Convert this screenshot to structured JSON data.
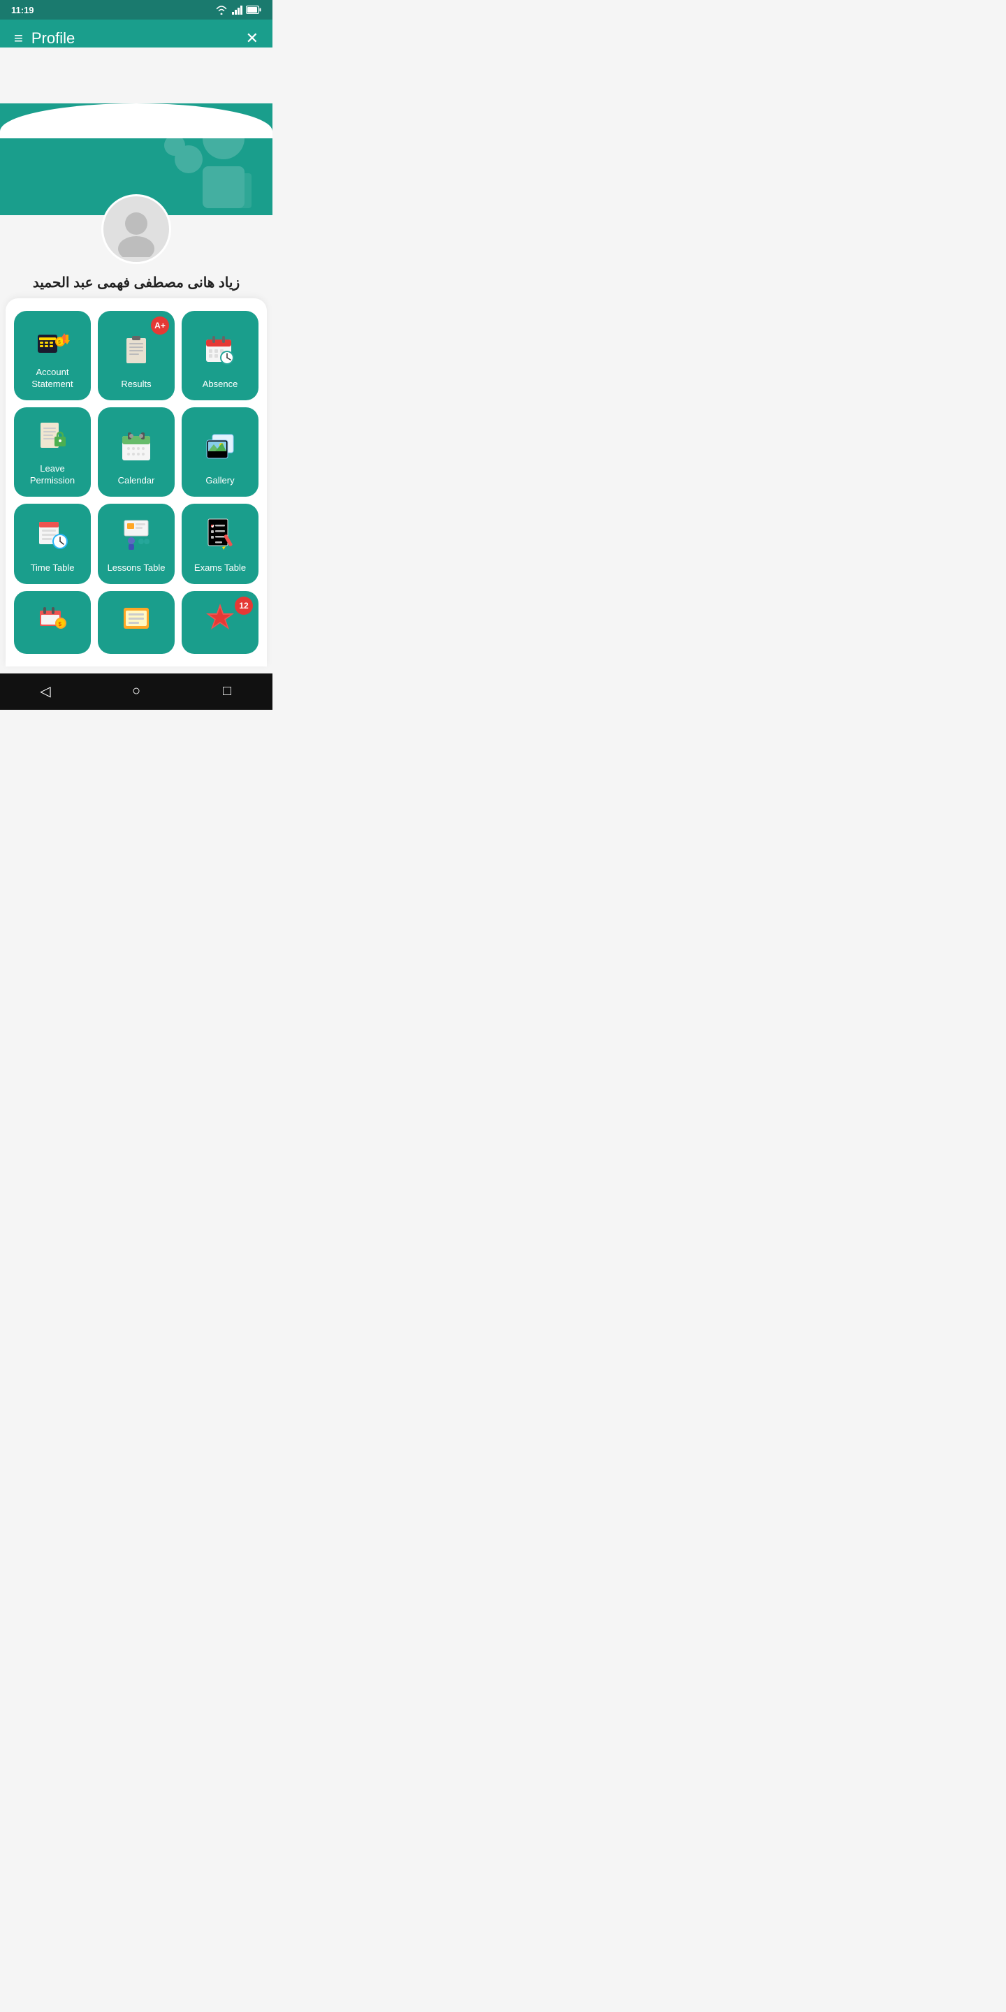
{
  "statusBar": {
    "time": "11:19",
    "wifi": "wifi-icon",
    "signal": "signal-icon",
    "battery": "battery-icon"
  },
  "header": {
    "menuIcon": "≡",
    "title": "Profile",
    "closeIcon": "✕"
  },
  "user": {
    "name": "زياد هانى مصطفى فهمى عبد الحميد"
  },
  "cards": [
    {
      "id": "account-statement",
      "label": "Account\nStatement",
      "icon": "account",
      "badge": null
    },
    {
      "id": "results",
      "label": "Results",
      "icon": "results",
      "badge": "A+",
      "badgeColor": "#e53935"
    },
    {
      "id": "absence",
      "label": "Absence",
      "icon": "absence",
      "badge": null
    },
    {
      "id": "leave-permission",
      "label": "Leave\nPermission",
      "icon": "leave",
      "badge": null
    },
    {
      "id": "calendar",
      "label": "Calendar",
      "icon": "calendar",
      "badge": null
    },
    {
      "id": "gallery",
      "label": "Gallery",
      "icon": "gallery",
      "badge": null
    },
    {
      "id": "time-table",
      "label": "Time Table",
      "icon": "timetable",
      "badge": null
    },
    {
      "id": "lessons-table",
      "label": "Lessons Table",
      "icon": "lessons",
      "badge": null
    },
    {
      "id": "exams-table",
      "label": "Exams Table",
      "icon": "exams",
      "badge": null
    },
    {
      "id": "item-10",
      "label": "",
      "icon": "misc1",
      "badge": null
    },
    {
      "id": "item-11",
      "label": "",
      "icon": "misc2",
      "badge": null
    },
    {
      "id": "item-12",
      "label": "",
      "icon": "misc3",
      "badge": "12",
      "badgeColor": "#e53935"
    }
  ],
  "bottomNav": {
    "backIcon": "◁",
    "homeIcon": "○",
    "recentIcon": "□"
  }
}
